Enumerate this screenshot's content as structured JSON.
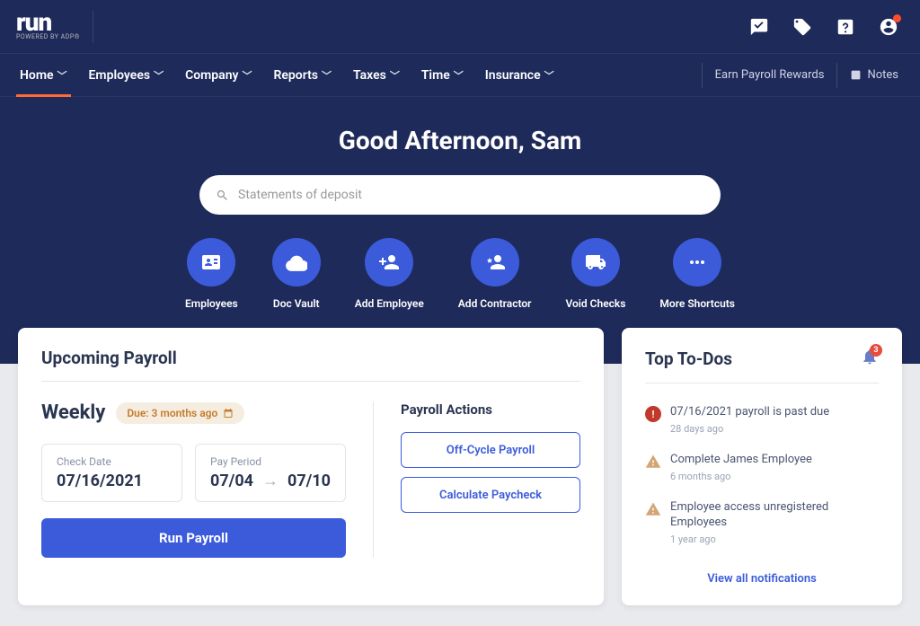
{
  "logo": {
    "main": "run",
    "sub": "POWERED BY ADP®"
  },
  "nav": {
    "items": [
      {
        "label": "Home",
        "active": true
      },
      {
        "label": "Employees"
      },
      {
        "label": "Company"
      },
      {
        "label": "Reports"
      },
      {
        "label": "Taxes"
      },
      {
        "label": "Time"
      },
      {
        "label": "Insurance"
      }
    ],
    "rewards": "Earn Payroll Rewards",
    "notes": "Notes"
  },
  "greeting": "Good Afternoon, Sam",
  "search": {
    "placeholder": "Statements of deposit"
  },
  "shortcuts": [
    {
      "label": "Employees",
      "icon": "id-card"
    },
    {
      "label": "Doc Vault",
      "icon": "cloud"
    },
    {
      "label": "Add Employee",
      "icon": "user-plus"
    },
    {
      "label": "Add Contractor",
      "icon": "user-star"
    },
    {
      "label": "Void Checks",
      "icon": "truck"
    },
    {
      "label": "More Shortcuts",
      "icon": "dots"
    }
  ],
  "upcoming": {
    "title": "Upcoming Payroll",
    "frequency": "Weekly",
    "due": "Due: 3 months ago",
    "check_date_label": "Check Date",
    "check_date": "07/16/2021",
    "pay_period_label": "Pay Period",
    "pay_period_start": "07/04",
    "pay_period_end": "07/10",
    "run_button": "Run Payroll",
    "actions_title": "Payroll Actions",
    "actions": [
      {
        "label": "Off-Cycle Payroll"
      },
      {
        "label": "Calculate Paycheck"
      }
    ]
  },
  "todos": {
    "title": "Top To-Dos",
    "badge_count": "3",
    "items": [
      {
        "type": "err",
        "text": "07/16/2021 payroll is past due",
        "time": "28 days ago"
      },
      {
        "type": "warn",
        "text": "Complete James Employee",
        "time": "6 months ago"
      },
      {
        "type": "warn",
        "text": "Employee access unregistered Employees",
        "time": "1 year ago"
      }
    ],
    "view_all": "View all notifications"
  }
}
